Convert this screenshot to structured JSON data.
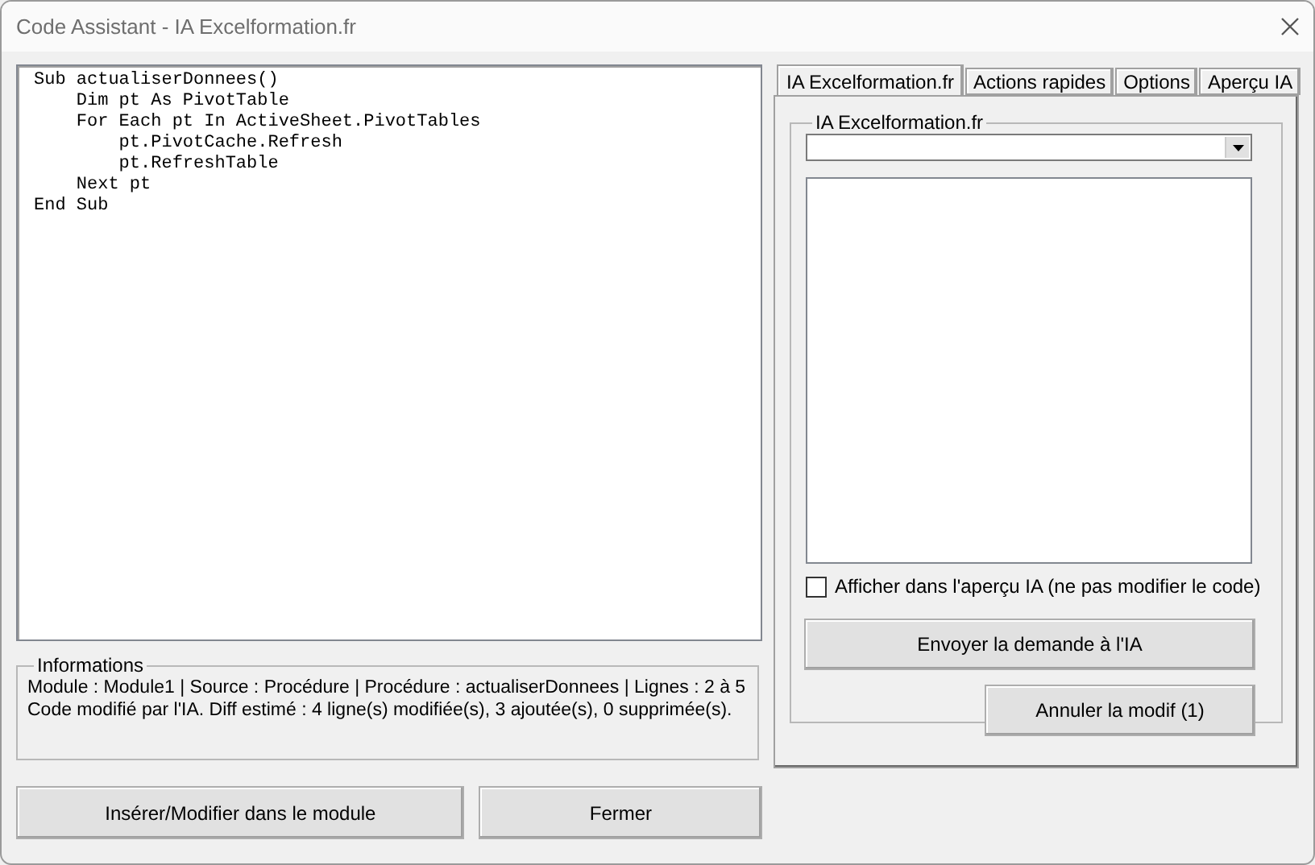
{
  "window": {
    "title": "Code Assistant - IA Excelformation.fr"
  },
  "code_editor": {
    "lines": [
      "Sub actualiserDonnees()",
      "    Dim pt As PivotTable",
      "    For Each pt In ActiveSheet.PivotTables",
      "        pt.PivotCache.Refresh",
      "        pt.RefreshTable",
      "    Next pt",
      "End Sub"
    ]
  },
  "informations": {
    "title": "Informations",
    "lines": [
      "Module : Module1 | Source : Procédure | Procédure : actualiserDonnees | Lignes : 2 à 5",
      "Code modifié par l'IA. Diff estimé : 4 ligne(s) modifiée(s), 3 ajoutée(s), 0 supprimée(s)."
    ]
  },
  "buttons": [
    {
      "label": "Insérer/Modifier dans le module"
    },
    {
      "label": "Fermer"
    }
  ],
  "tabs": [
    {
      "label": "IA Excelformation.fr",
      "selected": true
    },
    {
      "label": "Actions rapides",
      "selected": false
    },
    {
      "label": "Options",
      "selected": false
    },
    {
      "label": "Aperçu IA",
      "selected": false
    }
  ],
  "ia_panel": {
    "group_title": "IA Excelformation.fr",
    "checkbox": {
      "label": "Afficher dans l'aperçu IA (ne pas modifier le code)",
      "checked": false
    },
    "send_button": "Envoyer la demande à l'IA",
    "undo_button": "Annuler la modif (1)"
  }
}
